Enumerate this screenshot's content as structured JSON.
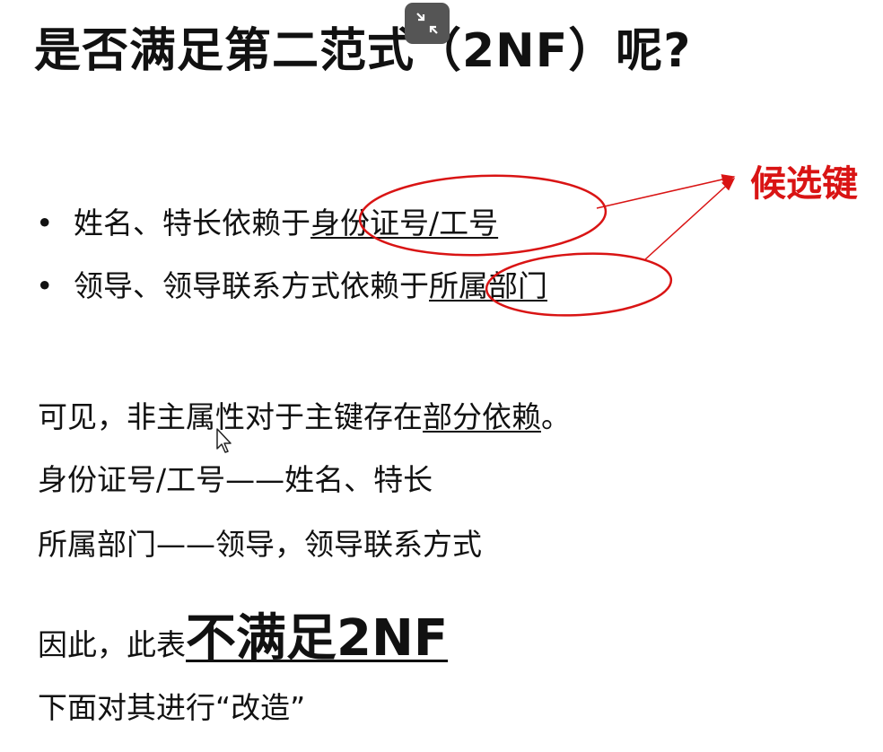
{
  "title": "是否满足第二范式（2NF）呢?",
  "bullets": [
    {
      "prefix": "姓名、特长依赖于",
      "key": "身份证号/工号"
    },
    {
      "prefix": "领导、领导联系方式依赖于",
      "key": "所属部门"
    }
  ],
  "annotation": "候选键",
  "paragraphs": {
    "line1_prefix": "可见，非主属性对于主键存在",
    "line1_key": "部分依赖",
    "line1_suffix": "。",
    "line2": "身份证号/工号——姓名、特长",
    "line3": "所属部门——领导，领导联系方式",
    "line4_prefix": "因此，此表",
    "line4_emphasis": "不满足2NF",
    "line5": "下面对其进行“改造”"
  },
  "colors": {
    "annotation": "#d91414",
    "text": "#111111",
    "button": "#555555"
  },
  "icons": {
    "fullscreen_button": "exit-fullscreen-icon",
    "cursor": "mouse-pointer-icon"
  }
}
